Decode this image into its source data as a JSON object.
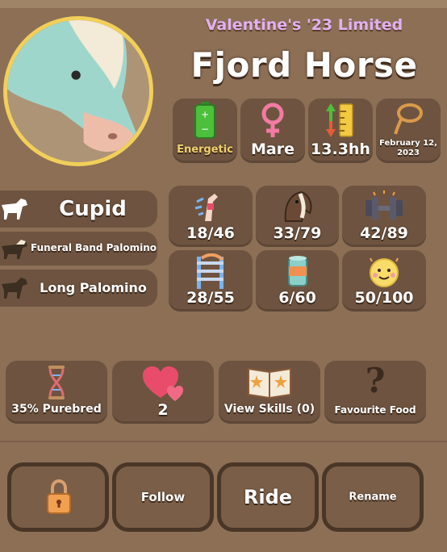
{
  "header": {
    "edition": "Valentine's '23 Limited",
    "breed": "Fjord Horse"
  },
  "attributes": [
    {
      "icon": "battery-icon",
      "label": "Energetic",
      "color": "#f0d070"
    },
    {
      "icon": "female-icon",
      "label": "Mare",
      "color": "#ffffff"
    },
    {
      "icon": "height-ruler-icon",
      "label": "13.3hh",
      "color": "#ffffff"
    },
    {
      "icon": "lasso-icon",
      "label": "February 12, 2023",
      "color": "#ffffff"
    }
  ],
  "genetics": {
    "horse_name": "Cupid",
    "line1": "Funeral Band Palomino",
    "line2": "Long Palomino"
  },
  "stats": [
    {
      "icon": "speed-leg-icon",
      "value": "18/46"
    },
    {
      "icon": "horse-head-icon",
      "value": "33/79"
    },
    {
      "icon": "dumbbell-icon",
      "value": "42/89"
    },
    {
      "icon": "jump-hurdle-icon",
      "value": "28/55"
    },
    {
      "icon": "food-can-icon",
      "value": "6/60"
    },
    {
      "icon": "happy-face-icon",
      "value": "50/100"
    }
  ],
  "info": {
    "purebred": "35% Purebred",
    "hearts": "2",
    "skills": "View Skills (0)",
    "food": "Favourite Food"
  },
  "actions": {
    "follow": "Follow",
    "ride": "Ride",
    "rename": "Rename"
  },
  "colors": {
    "background": "#8c6f55",
    "card": "#6e5440",
    "accent_gold": "#f1cf5a",
    "edition_purple": "#e2b0f2"
  }
}
